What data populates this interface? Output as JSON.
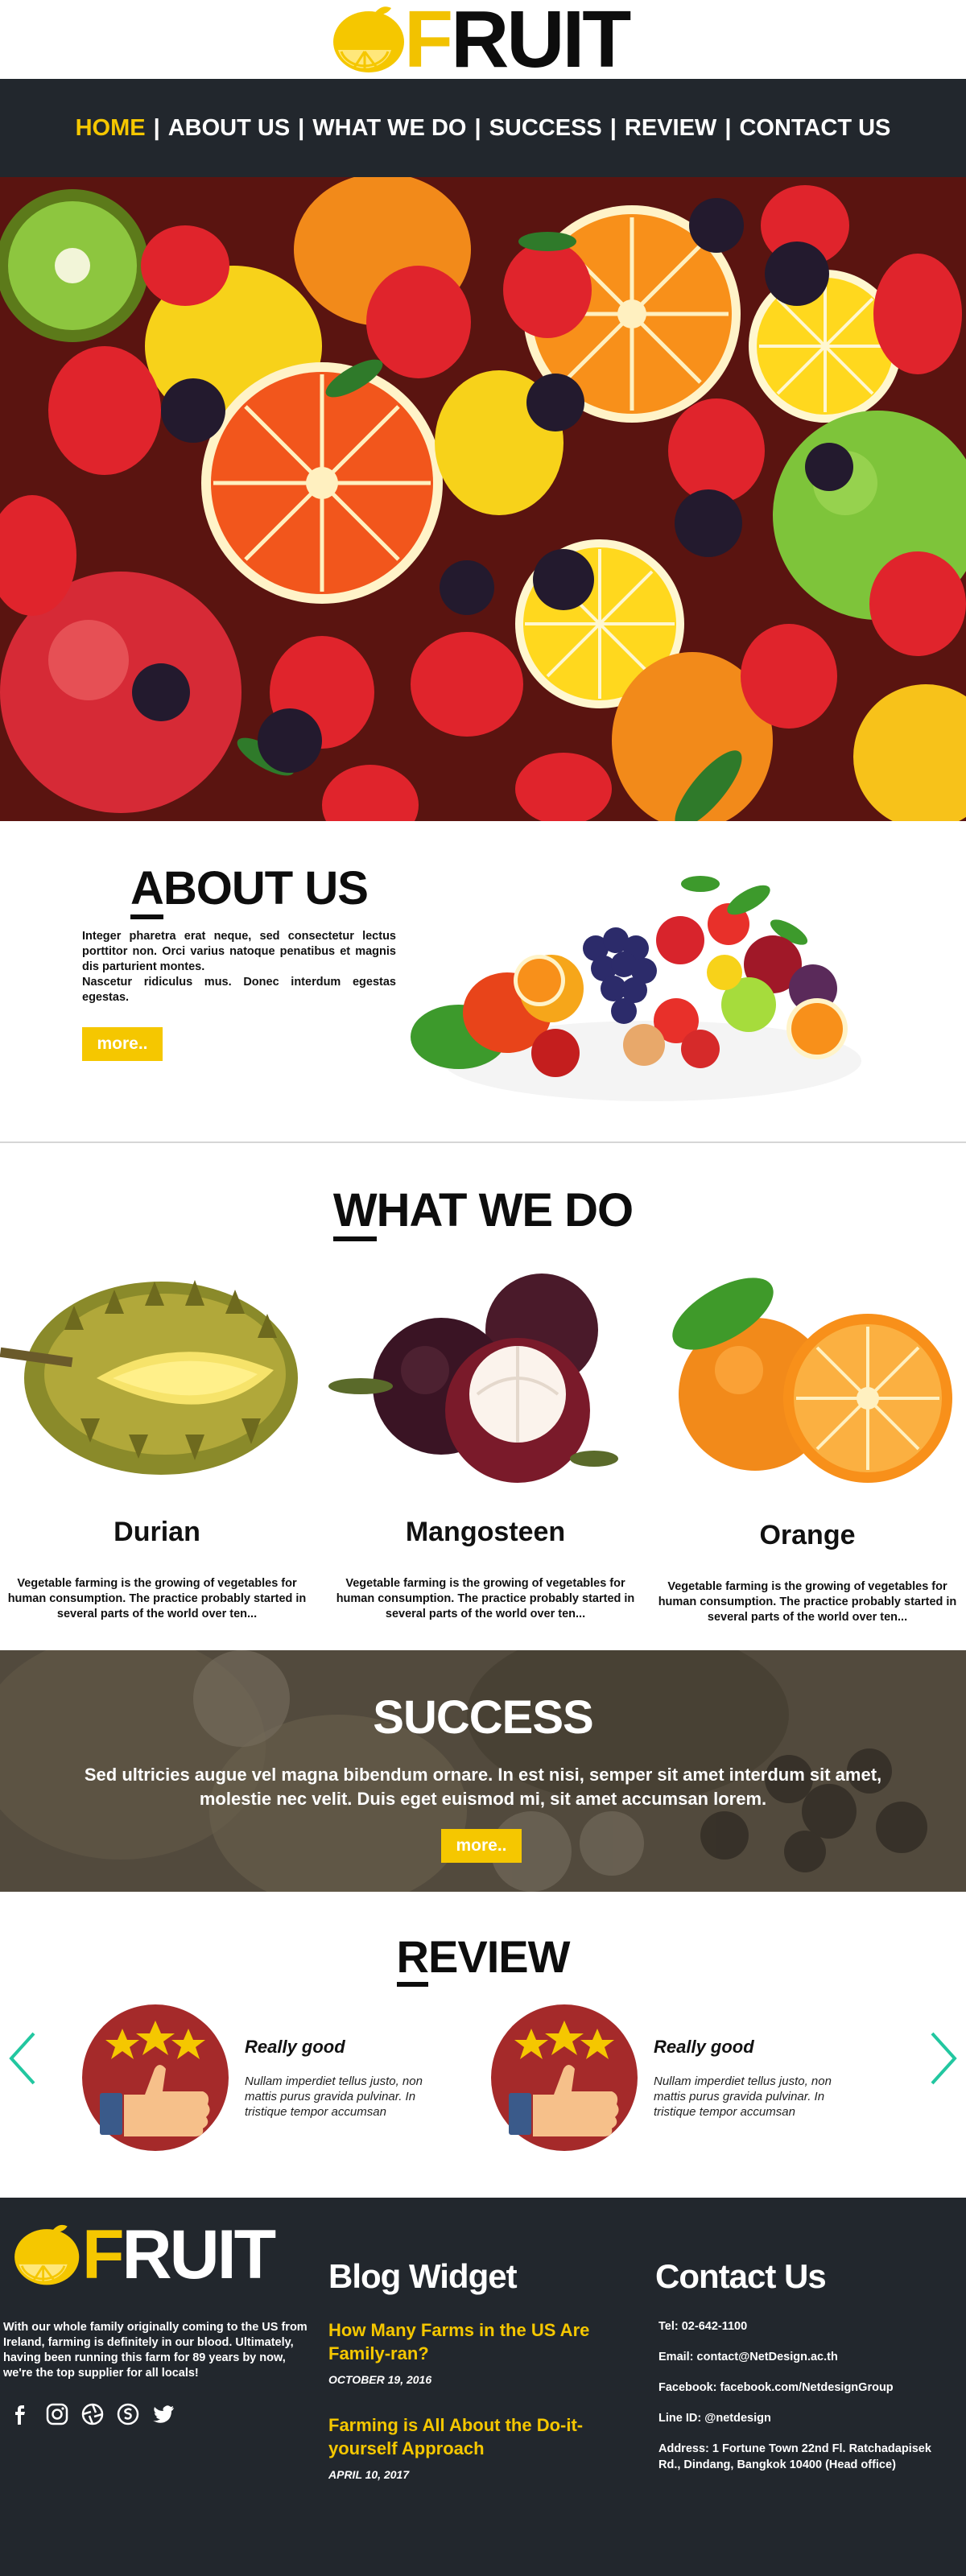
{
  "brand": {
    "name_first": "F",
    "name_rest": "RUIT"
  },
  "nav": {
    "items": [
      "HOME",
      "ABOUT US",
      "WHAT WE DO",
      "SUCCESS",
      "REVIEW",
      "CONTACT US"
    ],
    "separator": "|"
  },
  "about": {
    "title_first": "A",
    "title_rest": "BOUT US",
    "text_1": "Integer pharetra erat neque, sed consectetur lectus porttitor non. Orci varius natoque penatibus et magnis dis parturient montes.",
    "text_2": "Nascetur ridiculus mus. Donec interdum egestas egestas.",
    "more": "more.."
  },
  "what": {
    "title_first": "W",
    "title_rest": "HAT WE DO",
    "cards": [
      {
        "name": "Durian",
        "desc": "Vegetable farming is the growing of vegetables for human consumption. The practice probably started in several parts of the world over ten..."
      },
      {
        "name": "Mangosteen",
        "desc": "Vegetable farming is the growing of vegetables for human consumption. The practice probably started in several parts of the world over ten..."
      },
      {
        "name": "Orange",
        "desc": "Vegetable farming is the growing of vegetables for human consumption. The practice probably started in several parts of the world over ten..."
      }
    ]
  },
  "success": {
    "title": "SUCCESS",
    "text": "Sed ultricies augue vel magna bibendum ornare. In est nisi, semper sit amet interdum sit amet, molestie nec velit. Duis eget euismod mi, sit amet accumsan lorem.",
    "more": "more.."
  },
  "review": {
    "title_first": "R",
    "title_rest": "EVIEW",
    "cards": [
      {
        "heading": "Really good",
        "text": "Nullam imperdiet tellus justo, non mattis purus gravida pulvinar. In tristique tempor accumsan"
      },
      {
        "heading": "Really good",
        "text": "Nullam imperdiet tellus justo, non mattis purus gravida pulvinar. In tristique tempor accumsan"
      }
    ]
  },
  "footer": {
    "about": "With our whole family originally coming to the US from Ireland, farming is definitely in our blood. Ultimately, having been running this farm for 89 years by now, we're the top supplier for all locals!",
    "blog_title": "Blog Widget",
    "posts": [
      {
        "title": "How Many Farms in the US Are Family-ran?",
        "date": "OCTOBER 19, 2016"
      },
      {
        "title": "Farming is All About the Do-it-yourself Approach",
        "date": "APRIL 10, 2017"
      }
    ],
    "contact_title": "Contact Us",
    "tel": "Tel: 02-642-1100",
    "email": "Email: contact@NetDesign.ac.th",
    "facebook": "Facebook: facebook.com/NetdesignGroup",
    "line": "Line ID: @netdesign",
    "address": "Address: 1 Fortune Town 22nd Fl. Ratchadapisek Rd., Dindang, Bangkok 10400 (Head office)"
  },
  "colors": {
    "accent": "#f5c700",
    "dark": "#22272d",
    "review_badge": "#a52a2a"
  }
}
